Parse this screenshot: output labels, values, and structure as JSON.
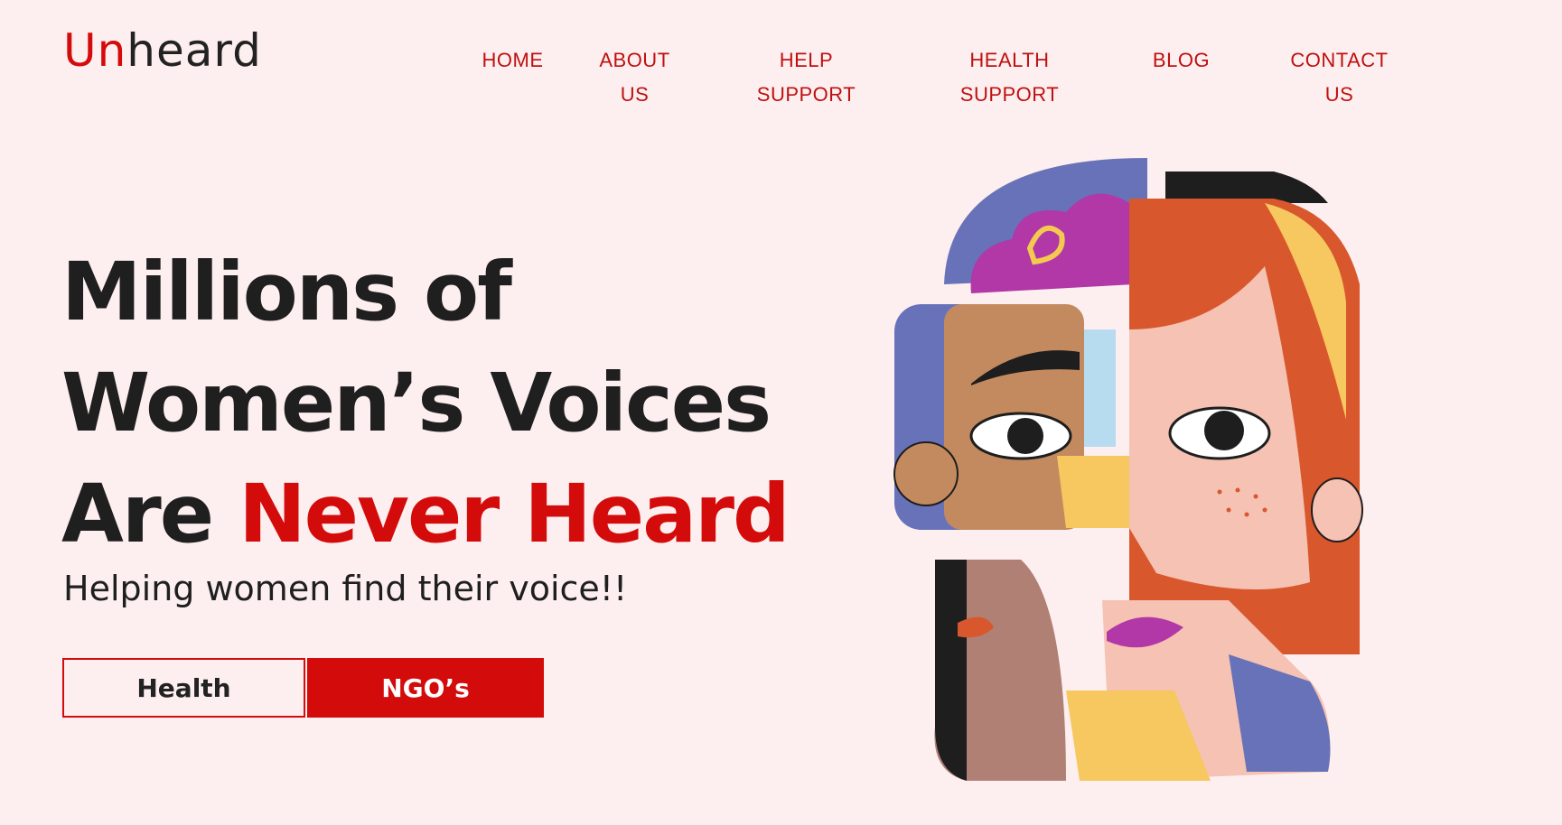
{
  "brand": {
    "logo_accent": "Un",
    "logo_rest": "heard"
  },
  "nav": [
    {
      "line1": "HOME",
      "line2": ""
    },
    {
      "line1": "ABOUT",
      "line2": "US"
    },
    {
      "line1": "HELP",
      "line2": "SUPPORT"
    },
    {
      "line1": "HEALTH",
      "line2": "SUPPORT"
    },
    {
      "line1": "BLOG",
      "line2": ""
    },
    {
      "line1": "CONTACT",
      "line2": "US"
    }
  ],
  "hero": {
    "line1": "Millions of",
    "line2": "Women’s Voices",
    "line3_dark": "Are ",
    "line3_red": "Never Heard",
    "subtitle": "Helping women find their voice!!"
  },
  "buttons": {
    "health": "Health",
    "ngo": "NGO’s"
  },
  "colors": {
    "accent": "#d40b0b",
    "background": "#fdefef",
    "text": "#1f1f1f"
  },
  "illustration": {
    "icon": "women-faces-collage-icon"
  }
}
